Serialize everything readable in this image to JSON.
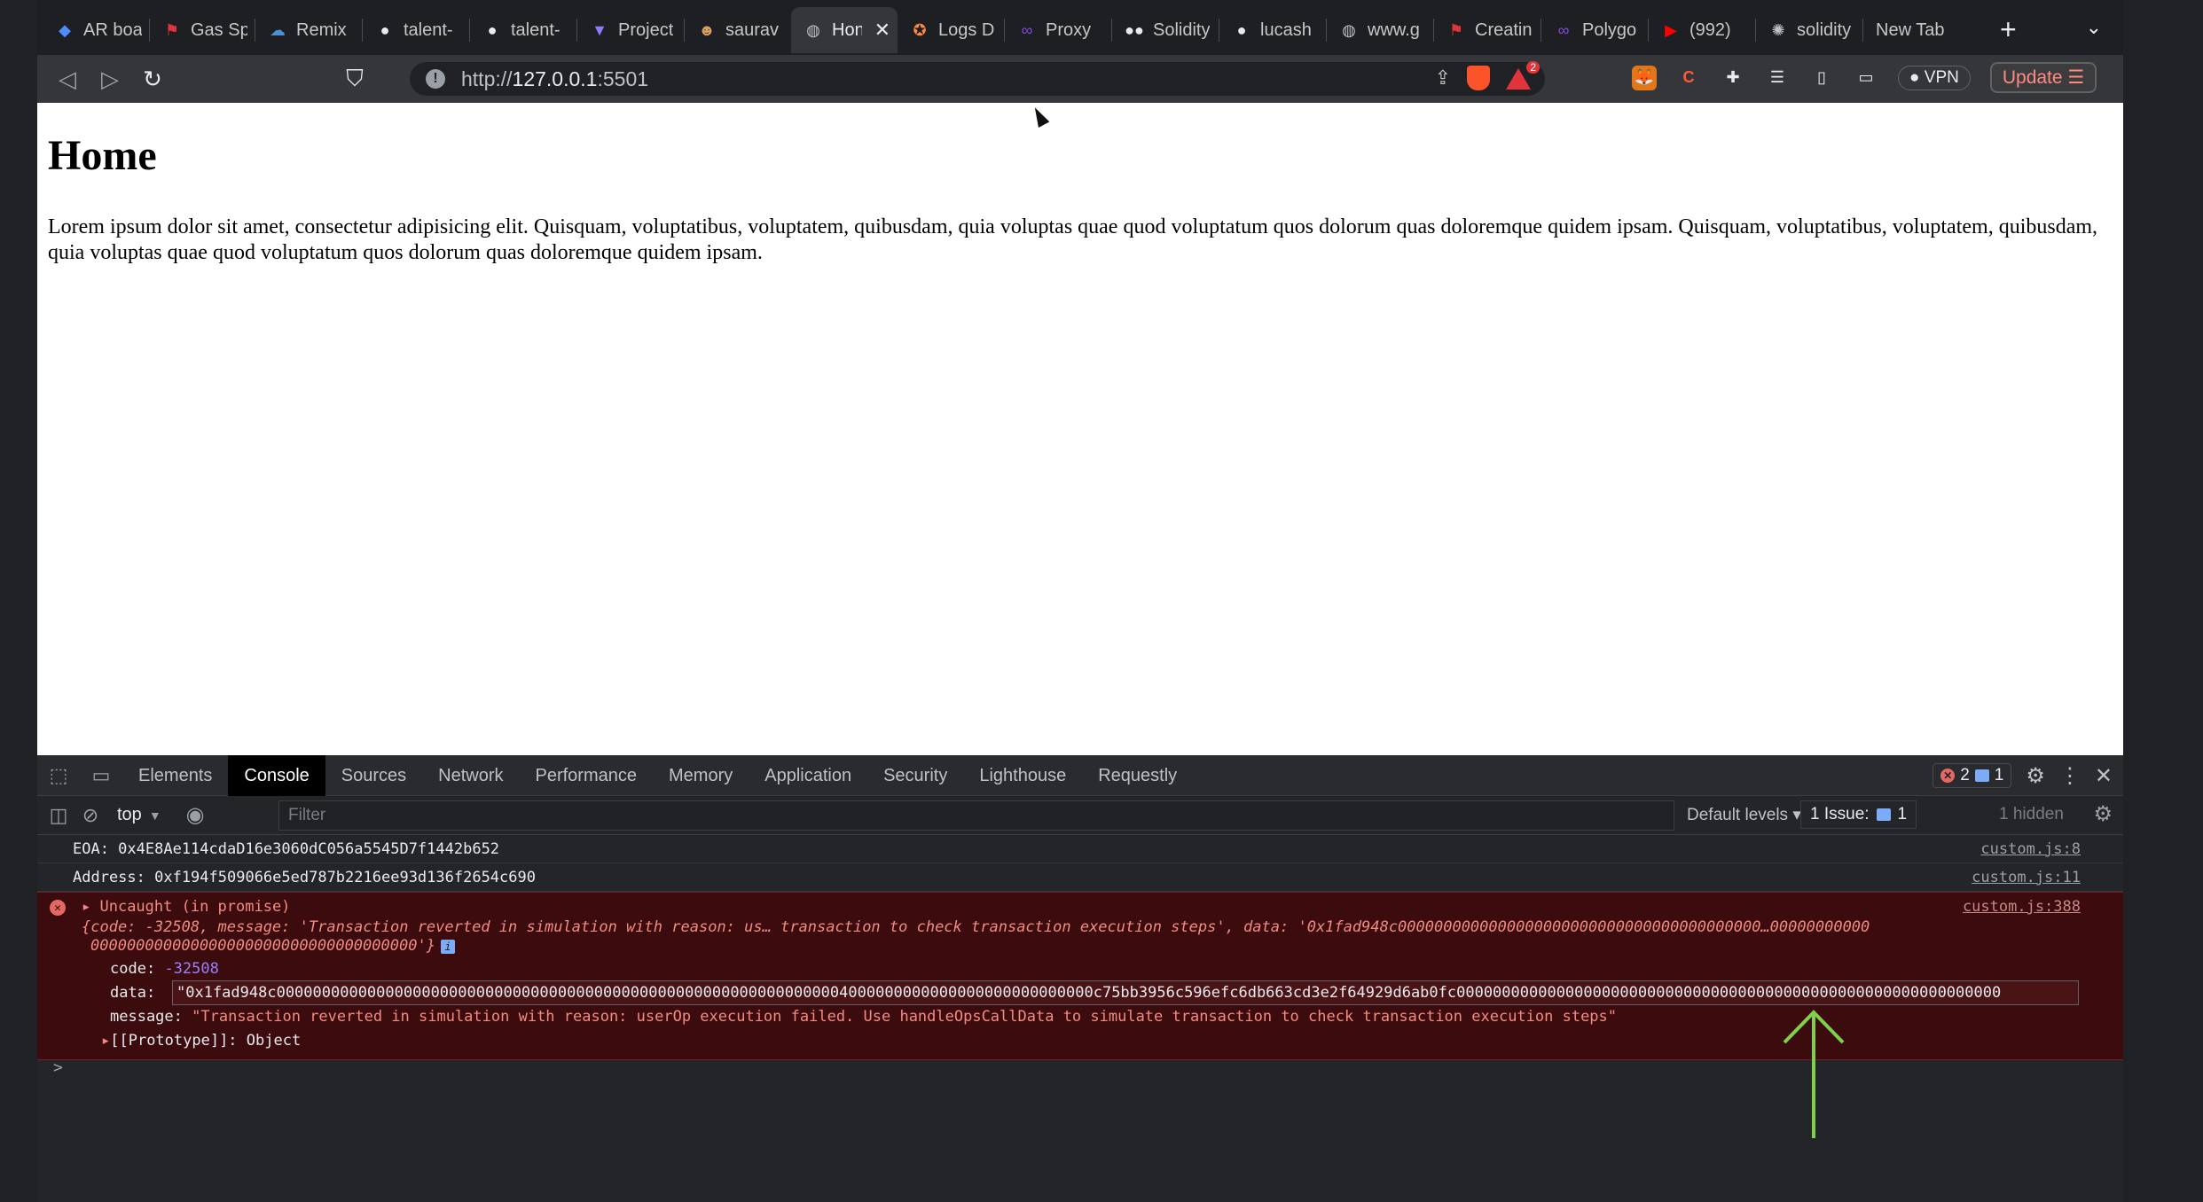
{
  "tabs": [
    {
      "label": "AR boa",
      "icon": "ar-icon",
      "color": "#4f8cff"
    },
    {
      "label": "Gas Sp",
      "icon": "flag-icon",
      "color": "#e3343b"
    },
    {
      "label": "Remix",
      "icon": "remix-icon",
      "color": "#4a90d9"
    },
    {
      "label": "talent-",
      "icon": "github-icon",
      "color": "#e8eaed"
    },
    {
      "label": "talent-",
      "icon": "github-icon",
      "color": "#e8eaed"
    },
    {
      "label": "Project",
      "icon": "project-icon",
      "color": "#8b7bff"
    },
    {
      "label": "saurav",
      "icon": "avatar-icon",
      "color": "#d9a066"
    },
    {
      "label": "Hon",
      "icon": "globe-icon",
      "color": "#bdc1c6",
      "active": true
    },
    {
      "label": "Logs D",
      "icon": "logs-icon",
      "color": "#ff8a3d"
    },
    {
      "label": "Proxy",
      "icon": "polygon-icon",
      "color": "#8247e5"
    },
    {
      "label": "Solidity",
      "icon": "medium-icon",
      "color": "#e8eaed"
    },
    {
      "label": "lucash",
      "icon": "github-icon",
      "color": "#e8eaed"
    },
    {
      "label": "www.g",
      "icon": "globe-icon",
      "color": "#bdc1c6"
    },
    {
      "label": "Creatin",
      "icon": "flag-icon",
      "color": "#e3343b"
    },
    {
      "label": "Polygo",
      "icon": "polygon-icon",
      "color": "#8247e5"
    },
    {
      "label": "(992)",
      "icon": "youtube-icon",
      "color": "#ff0000"
    },
    {
      "label": "solidity",
      "icon": "sun-icon",
      "color": "#bdc1c6"
    },
    {
      "label": "New Tab",
      "icon": "",
      "color": ""
    }
  ],
  "toolbar": {
    "url_host": "http://",
    "url_main": "127.0.0.1",
    "url_port": ":5501",
    "rewards_badge": "2",
    "vpn_label": "VPN",
    "update_label": "Update"
  },
  "page": {
    "title": "Home",
    "paragraph": "Lorem ipsum dolor sit amet, consectetur adipisicing elit. Quisquam, voluptatibus, voluptatem, quibusdam, quia voluptas quae quod voluptatum quos dolorum quas doloremque quidem ipsam. Quisquam, voluptatibus, voluptatem, quibusdam, quia voluptas quae quod voluptatum quos dolorum quas doloremque quidem ipsam."
  },
  "devtools": {
    "tabs": [
      "Elements",
      "Console",
      "Sources",
      "Network",
      "Performance",
      "Memory",
      "Application",
      "Security",
      "Lighthouse",
      "Requestly"
    ],
    "active_tab": "Console",
    "error_count": "2",
    "message_count": "1",
    "context": "top",
    "filter_placeholder": "Filter",
    "levels_label": "Default levels",
    "issues_label": "1 Issue:",
    "issues_count": "1",
    "hidden_label": "1 hidden"
  },
  "console": {
    "eoa_line": "EOA:  0x4E8Ae114cdaD16e3060dC056a5545D7f1442b652",
    "eoa_src": "custom.js:8",
    "address_line": "Address: 0xf194f509066e5ed787b2216ee93d136f2654c690",
    "address_src": "custom.js:11",
    "error_title": "Uncaught (in promise)",
    "error_src": "custom.js:388",
    "error_summary_1": "{code: -32508, message: 'Transaction reverted in simulation with reason: us… transaction to check transaction execution steps', data: '0x1fad948c0000000000000000000000000000000000000000…00000000000",
    "error_summary_2": "000000000000000000000000000000000000'}",
    "code_key": "code:",
    "code_value": "-32508",
    "data_key": "data:",
    "data_value": "\"0x1fad948c000000000000000000000000000000000000000000000000000000000000004000000000000000000000000000c75bb3956c596efc6db663cd3e2f64929d6ab0fc000000000000000000000000000000000000000000000000000000000000",
    "message_key": "message:",
    "message_value": "\"Transaction reverted in simulation with reason: userOp execution failed. Use handleOpsCallData to simulate transaction to check transaction execution steps\"",
    "prototype_key": "[[Prototype]]:",
    "prototype_value": "Object",
    "prompt": ">"
  },
  "colors": {
    "annotation_arrow": "#7fd14a",
    "error_bg": "#3b0b0e",
    "tab_active_bg": "#35363a"
  }
}
